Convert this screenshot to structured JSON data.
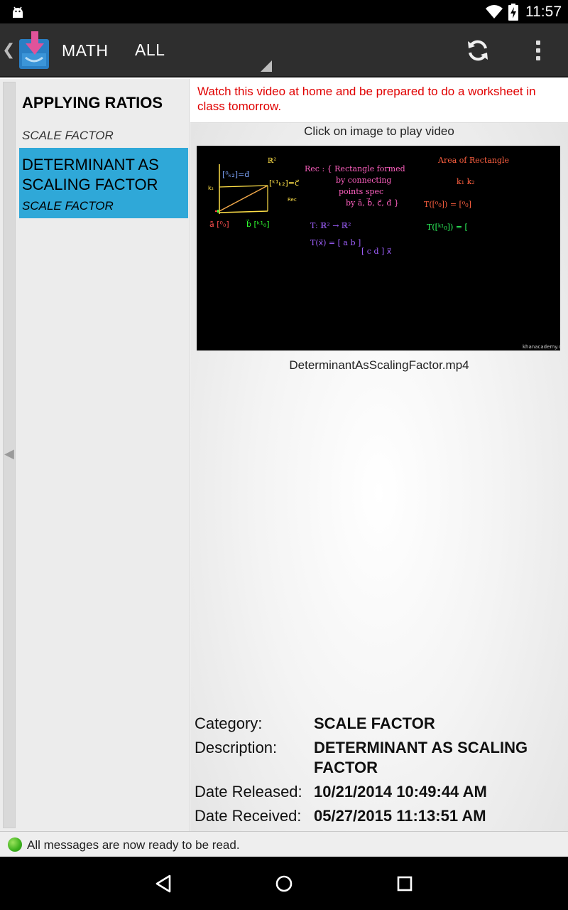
{
  "status_bar": {
    "time": "11:57",
    "icons": [
      "android-icon",
      "wifi-icon",
      "battery-charging-icon"
    ]
  },
  "action_bar": {
    "title": "MATH",
    "filter": "ALL",
    "icons": [
      "app-logo-icon",
      "refresh-icon",
      "overflow-menu-icon"
    ]
  },
  "sidebar": {
    "group_title": "APPLYING RATIOS",
    "group_subtitle": "SCALE FACTOR",
    "selected_item": {
      "title": "DETERMINANT AS SCALING FACTOR",
      "subtitle": "SCALE FACTOR"
    },
    "accent_color": "#2fa8d8"
  },
  "content": {
    "notice": "Watch this video at home and be prepared to do a worksheet in class tomorrow.",
    "notice_color": "#e00000",
    "play_hint": "Click on image to play video",
    "filename": "DeterminantAsScalingFactor.mp4",
    "watermark": "khanacademy.org",
    "details": [
      {
        "label": "Category:",
        "value": "SCALE FACTOR"
      },
      {
        "label": "Description:",
        "value": "DETERMINANT AS SCALING FACTOR"
      },
      {
        "label": "Date Released:",
        "value": "10/21/2014 10:49:44 AM"
      },
      {
        "label": "Date Received:",
        "value": "05/27/2015 11:13:51 AM"
      }
    ]
  },
  "footer": {
    "message": "All messages are now ready to be read."
  },
  "nav_bar": {
    "icons": [
      "back-icon",
      "home-icon",
      "recents-icon"
    ]
  }
}
